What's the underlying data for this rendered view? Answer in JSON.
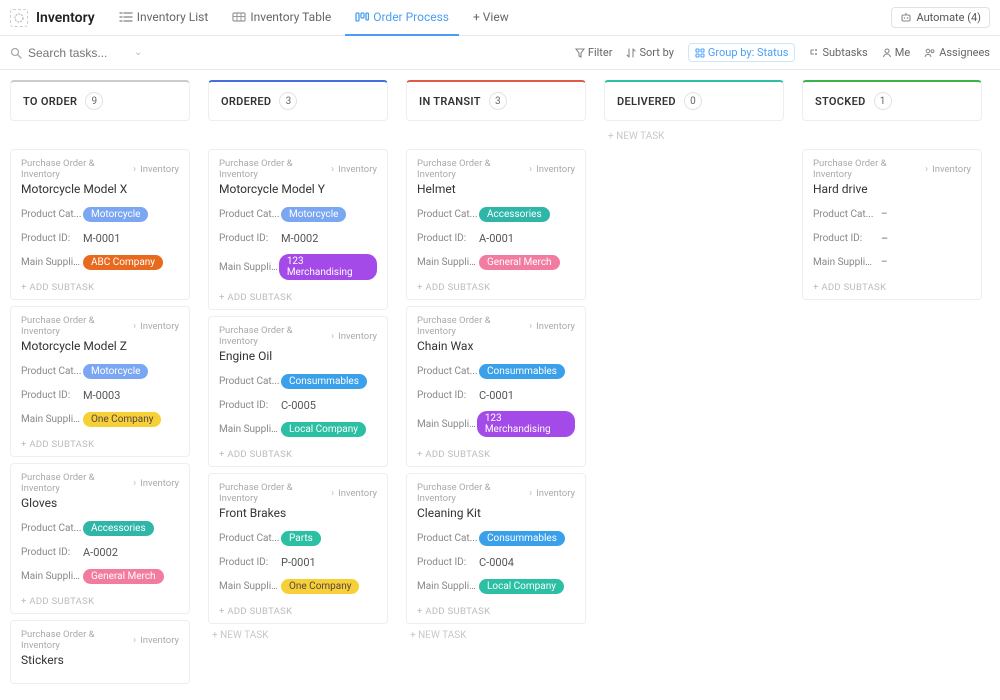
{
  "header": {
    "title": "Inventory",
    "tabs": [
      {
        "label": "Inventory List",
        "active": false
      },
      {
        "label": "Inventory Table",
        "active": false
      },
      {
        "label": "Order Process",
        "active": true
      },
      {
        "label": "+ View",
        "active": false
      }
    ],
    "automate_label": "Automate (4)"
  },
  "toolbar": {
    "search_placeholder": "Search tasks...",
    "filter_label": "Filter",
    "sortby_label": "Sort by",
    "groupby_label": "Group by: Status",
    "subtasks_label": "Subtasks",
    "me_label": "Me",
    "assignees_label": "Assignees"
  },
  "breadcrumb": {
    "parent": "Purchase Order & Inventory",
    "child": "Inventory"
  },
  "field_labels": {
    "category": "Product Cat...",
    "product_id": "Product ID:",
    "supplier": "Main Supplier:",
    "add_subtask": "+ ADD SUBTASK",
    "new_task": "+ NEW TASK"
  },
  "pill_colors": {
    "Motorcycle": "#7ba6f2",
    "Accessories": "#2fb6a8",
    "Consummables": "#3aa0e9",
    "Parts": "#2bbfa3",
    "ABC Company": "#e86a1f",
    "123 Merchandising": "#a44ae8",
    "One Company": "#f7d038",
    "Local Company": "#2bbfa3",
    "General Merch": "#f27ba0"
  },
  "columns": [
    {
      "name": "TO ORDER",
      "count": 9,
      "accent": "gray",
      "cards": [
        {
          "title": "Motorcycle Model X",
          "category": "Motorcycle",
          "product_id": "M-0001",
          "supplier": "ABC Company"
        },
        {
          "title": "Motorcycle Model Z",
          "category": "Motorcycle",
          "product_id": "M-0003",
          "supplier": "One Company"
        },
        {
          "title": "Gloves",
          "category": "Accessories",
          "product_id": "A-0002",
          "supplier": "General Merch"
        },
        {
          "title": "Stickers",
          "category": "",
          "product_id": "",
          "supplier": "",
          "partial": true
        }
      ],
      "show_new_task": false
    },
    {
      "name": "ORDERED",
      "count": 3,
      "accent": "blue",
      "cards": [
        {
          "title": "Motorcycle Model Y",
          "category": "Motorcycle",
          "product_id": "M-0002",
          "supplier": "123 Merchandising"
        },
        {
          "title": "Engine Oil",
          "category": "Consummables",
          "product_id": "C-0005",
          "supplier": "Local Company"
        },
        {
          "title": "Front Brakes",
          "category": "Parts",
          "product_id": "P-0001",
          "supplier": "One Company"
        }
      ],
      "show_new_task": true
    },
    {
      "name": "IN TRANSIT",
      "count": 3,
      "accent": "red",
      "cards": [
        {
          "title": "Helmet",
          "category": "Accessories",
          "product_id": "A-0001",
          "supplier": "General Merch"
        },
        {
          "title": "Chain Wax",
          "category": "Consummables",
          "product_id": "C-0001",
          "supplier": "123 Merchandising"
        },
        {
          "title": "Cleaning Kit",
          "category": "Consummables",
          "product_id": "C-0004",
          "supplier": "Local Company"
        }
      ],
      "show_new_task": true
    },
    {
      "name": "DELIVERED",
      "count": 0,
      "accent": "teal",
      "cards": [],
      "show_new_task": true
    },
    {
      "name": "STOCKED",
      "count": 1,
      "accent": "green",
      "cards": [
        {
          "title": "Hard drive",
          "category": "",
          "product_id": "",
          "supplier": ""
        }
      ],
      "show_new_task": false
    }
  ]
}
